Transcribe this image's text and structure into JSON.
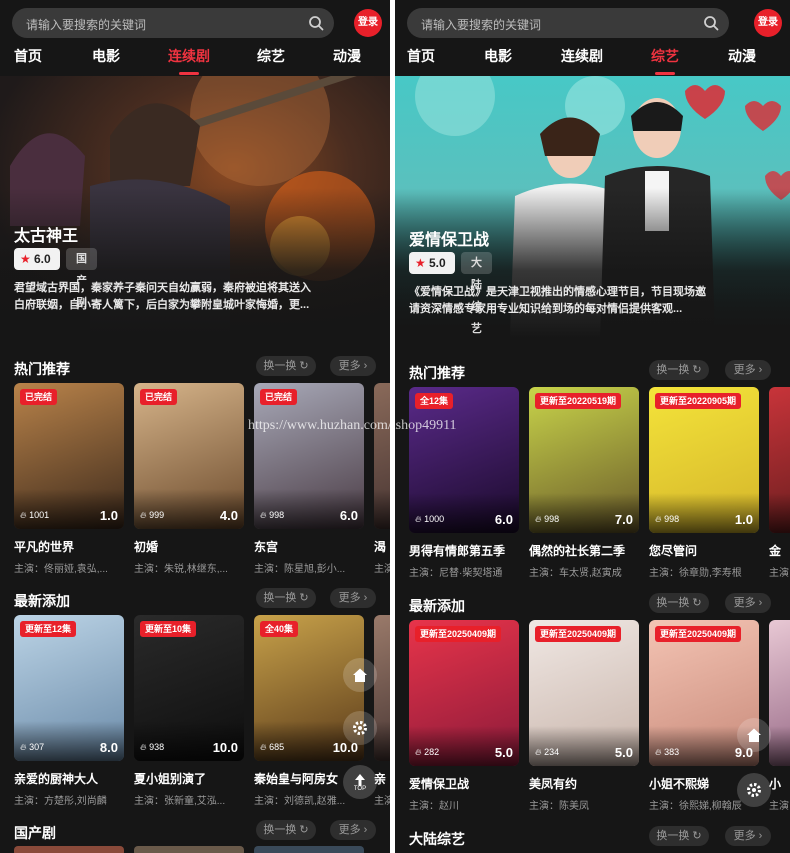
{
  "left": {
    "search_placeholder": "请输入要搜索的关键词",
    "login_label": "登录",
    "nav": [
      "首页",
      "电影",
      "连续剧",
      "综艺",
      "动漫"
    ],
    "active_tab": 2,
    "hero": {
      "title": "太古神王",
      "score": "6.0",
      "category": "国产剧",
      "desc": "君望域古界国，秦家养子秦问天自幼赢弱，秦府被迫将其送入白府联姻，自小寄人篱下，后白家为攀附皇城叶家悔婚，更..."
    },
    "sections": [
      {
        "title": "热门推荐",
        "refresh": "换一换",
        "more": "更多",
        "cards": [
          {
            "badge": "已完结",
            "views": "1001",
            "rating": "1.0",
            "title": "平凡的世界",
            "sub": "主演：佟丽娅,袁弘,...",
            "colors": [
              "#b9834a",
              "#3d2a1c"
            ]
          },
          {
            "badge": "已完结",
            "views": "999",
            "rating": "4.0",
            "title": "初婚",
            "sub": "主演：朱锐,林继东,...",
            "colors": [
              "#d6b48a",
              "#6b4a2c"
            ]
          },
          {
            "badge": "已完结",
            "views": "998",
            "rating": "6.0",
            "title": "东宫",
            "sub": "主演：陈星旭,彭小...",
            "colors": [
              "#a8a9b8",
              "#4a3b44"
            ]
          },
          {
            "badge": "",
            "views": "",
            "rating": "",
            "title": "渴",
            "sub": "主演",
            "colors": [
              "#8a6a5a",
              "#3a2a2a"
            ]
          }
        ]
      },
      {
        "title": "最新添加",
        "refresh": "换一换",
        "more": "更多",
        "cards": [
          {
            "badge": "更新至12集",
            "views": "307",
            "rating": "8.0",
            "title": "亲爱的厨神大人",
            "sub": "主演：方楚彤,刘尚麟",
            "colors": [
              "#bcd4e6",
              "#6a8aa8"
            ]
          },
          {
            "badge": "更新至10集",
            "views": "938",
            "rating": "10.0",
            "title": "夏小姐别演了",
            "sub": "主演：张新童,艾泓...",
            "colors": [
              "#2a2a2a",
              "#0e0e0e"
            ]
          },
          {
            "badge": "全40集",
            "views": "685",
            "rating": "10.0",
            "title": "秦始皇与阿房女",
            "sub": "主演：刘德凯,赵雅...",
            "colors": [
              "#c8a24a",
              "#5a3a1a"
            ]
          },
          {
            "badge": "",
            "views": "",
            "rating": "",
            "title": "亲",
            "sub": "主演",
            "colors": [
              "#9a7a6a",
              "#3a2a2a"
            ]
          }
        ]
      },
      {
        "title": "国产剧",
        "refresh": "换一换",
        "more": "更多"
      }
    ]
  },
  "right": {
    "search_placeholder": "请输入要搜索的关键词",
    "login_label": "登录",
    "nav": [
      "首页",
      "电影",
      "连续剧",
      "综艺",
      "动漫"
    ],
    "active_tab": 3,
    "hero": {
      "title": "爱情保卫战",
      "score": "5.0",
      "category": "大陆综艺",
      "desc": "《爱情保卫战》是天津卫视推出的情感心理节目，节目现场邀请资深情感专家用专业知识给到场的每对情侣提供客观..."
    },
    "sections": [
      {
        "title": "热门推荐",
        "refresh": "换一换",
        "more": "更多",
        "cards": [
          {
            "badge": "全12集",
            "views": "1000",
            "rating": "6.0",
            "title": "男得有情郎第五季",
            "sub": "主演：尼替·柴契塔通",
            "colors": [
              "#5a2a8a",
              "#1a0a2a"
            ]
          },
          {
            "badge": "更新至20220519期",
            "views": "998",
            "rating": "7.0",
            "title": "偶然的社长第二季",
            "sub": "主演：车太贤,赵寅成",
            "colors": [
              "#c8d44a",
              "#6a5a2a"
            ]
          },
          {
            "badge": "更新至20220905期",
            "views": "998",
            "rating": "1.0",
            "title": "您尽管问",
            "sub": "主演：徐章勋,李寿根",
            "colors": [
              "#f4e43a",
              "#d4b42a"
            ]
          },
          {
            "badge": "",
            "views": "",
            "rating": "",
            "title": "金",
            "sub": "主演",
            "colors": [
              "#c8343a",
              "#5a1a1a"
            ]
          }
        ]
      },
      {
        "title": "最新添加",
        "refresh": "换一换",
        "more": "更多",
        "cards": [
          {
            "badge": "更新至20250409期",
            "views": "282",
            "rating": "5.0",
            "title": "爱情保卫战",
            "sub": "主演：赵川",
            "colors": [
              "#e8344a",
              "#8a1a3a"
            ]
          },
          {
            "badge": "更新至20250409期",
            "views": "234",
            "rating": "5.0",
            "title": "美凤有约",
            "sub": "主演：陈美凤",
            "colors": [
              "#f0e8e4",
              "#c8b4aa"
            ]
          },
          {
            "badge": "更新至20250409期",
            "views": "383",
            "rating": "9.0",
            "title": "小姐不熙娣",
            "sub": "主演：徐熙娣,柳翰辰",
            "colors": [
              "#f4c4b4",
              "#c88a7a"
            ]
          },
          {
            "badge": "",
            "views": "",
            "rating": "",
            "title": "小",
            "sub": "主演",
            "colors": [
              "#e8c8d4",
              "#8a5a7a"
            ]
          }
        ]
      },
      {
        "title": "大陆综艺",
        "refresh": "换一换",
        "more": "更多"
      }
    ]
  },
  "watermark": "https://www.huzhan.com/ishop49911",
  "fab_top_label": "TOP"
}
